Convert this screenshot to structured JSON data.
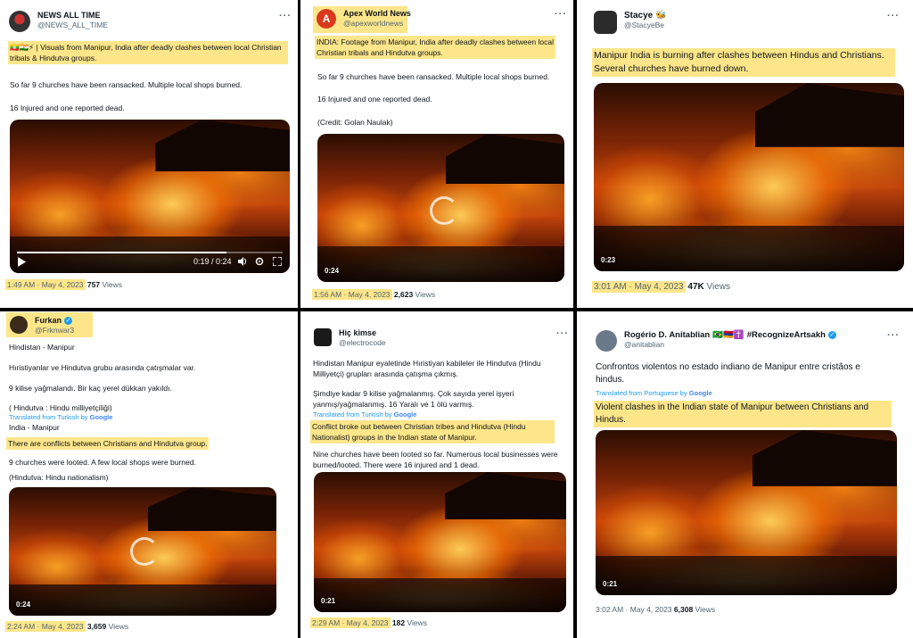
{
  "panels": [
    {
      "name": "NEWS ALL TIME",
      "handle": "@NEWS_ALL_TIME",
      "flag_emojis": "🇲🇲🇮🇳⚡",
      "highlight_text": "| Visuals from Manipur, India after deadly clashes between local Christian tribals & Hindutva groups.",
      "p1": "So far 9 churches have been ransacked. Multiple local shops burned.",
      "p2": "16 Injured and one reported dead.",
      "video_time": "0:19 / 0:24",
      "video_progress": 0.79,
      "timestamp": "1:49 AM · May 4, 2023",
      "views_count": "757",
      "views_label": "Views"
    },
    {
      "name": "Apex World News",
      "handle": "@apexworldnews",
      "avatar_letter": "A",
      "highlight_text": "INDIA: Footage from Manipur, India after deadly clashes between local Christian tribals and Hindutva groups.",
      "p1": "So far 9 churches have been ransacked. Multiple local shops burned.",
      "p2": "16 Injured and one reported dead.",
      "p3": "(Credit: Golan Naulak)",
      "video_time": "0:24",
      "timestamp": "1:56 AM · May 4, 2023",
      "views_count": "2,623",
      "views_label": "Views"
    },
    {
      "name": "Stacye",
      "name_emoji": "🐝",
      "handle": "@StacyeBe",
      "highlight_text": "Manipur India is burning after clashes between Hindus and Christians. Several churches have burned down.",
      "video_time": "0:23",
      "timestamp": "3:01 AM · May 4, 2023",
      "views_count": "47K",
      "views_label": "Views"
    },
    {
      "name": "Furkan",
      "handle": "@Frknwar3",
      "l1": "Hindistan - Manipur",
      "l2": "Hıristiyanlar ve Hindutva grubu arasında çatışmalar var.",
      "l3": "9 kilise yağmalandı. Bir kaç yerel dükkan yakıldı.",
      "l4": "( Hindutva : Hindu milliyetçiliği)",
      "translated_label": "Translated from Turkish by",
      "google": "Google",
      "l5": "India - Manipur",
      "highlight_text": "There are conflicts between Christians and Hindutva group.",
      "l6": "9 churches were looted. A few local shops were burned.",
      "l7": "(Hindutva: Hindu nationalism)",
      "video_time": "0:24",
      "timestamp": "2:24 AM · May 4, 2023",
      "views_count": "3,659",
      "views_label": "Views"
    },
    {
      "name": "Hiç kimse",
      "handle": "@electrocode",
      "l1": "Hindistan Manipur eyaletinde Hıristiyan kabileler ile Hindutva (Hindu Milliyetçi) grupları arasında çatışma çıkmış.",
      "l2": "Şimdiye kadar 9 kilise yağmalanmış. Çok sayıda yerel işyeri yanmış/yağmalanmış. 16 Yaralı ve 1 ölü varmış.",
      "translated_label": "Translated from Turkish by",
      "google": "Google",
      "highlight_text": "Conflict broke out between Christian tribes and Hindutva (Hindu Nationalist) groups in the Indian state of Manipur.",
      "l3": "Nine churches have been looted so far. Numerous local businesses were burned/looted. There were 16 injured and 1 dead.",
      "video_time": "0:21",
      "timestamp": "2:29 AM · May 4, 2023",
      "views_count": "182",
      "views_label": "Views"
    },
    {
      "name": "Rogério D. Anitablian",
      "name_suffix": "#RecognizeArtsakh",
      "name_emojis": "🇧🇷🇦🇲✝️",
      "handle": "@anitablian",
      "l1": "Confrontos violentos no estado indiano de Manipur entre cristãos e hindus.",
      "translated_label": "Translated from Portuguese by",
      "google": "Google",
      "highlight_text": "Violent clashes in the Indian state of Manipur between Christians and Hindus.",
      "video_time": "0:21",
      "timestamp": "3:02 AM · May 4, 2023",
      "views_count": "6,308",
      "views_label": "Views"
    }
  ],
  "more_icon": "···",
  "colors": {
    "highlight": "#fde68a",
    "link": "#1d9bf0",
    "muted": "#536471",
    "divider": "#000000"
  }
}
